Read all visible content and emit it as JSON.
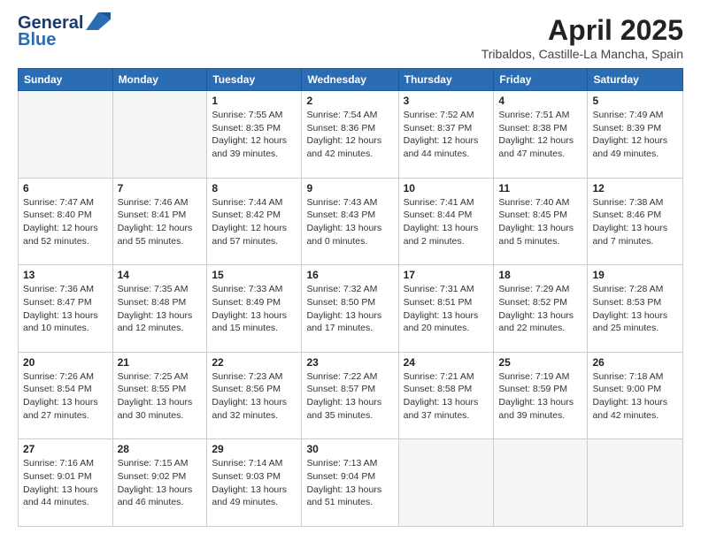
{
  "logo": {
    "line1": "General",
    "line2": "Blue"
  },
  "header": {
    "month_year": "April 2025",
    "location": "Tribaldos, Castille-La Mancha, Spain"
  },
  "days_of_week": [
    "Sunday",
    "Monday",
    "Tuesday",
    "Wednesday",
    "Thursday",
    "Friday",
    "Saturday"
  ],
  "weeks": [
    [
      {
        "day": "",
        "info": ""
      },
      {
        "day": "",
        "info": ""
      },
      {
        "day": "1",
        "info": "Sunrise: 7:55 AM\nSunset: 8:35 PM\nDaylight: 12 hours and 39 minutes."
      },
      {
        "day": "2",
        "info": "Sunrise: 7:54 AM\nSunset: 8:36 PM\nDaylight: 12 hours and 42 minutes."
      },
      {
        "day": "3",
        "info": "Sunrise: 7:52 AM\nSunset: 8:37 PM\nDaylight: 12 hours and 44 minutes."
      },
      {
        "day": "4",
        "info": "Sunrise: 7:51 AM\nSunset: 8:38 PM\nDaylight: 12 hours and 47 minutes."
      },
      {
        "day": "5",
        "info": "Sunrise: 7:49 AM\nSunset: 8:39 PM\nDaylight: 12 hours and 49 minutes."
      }
    ],
    [
      {
        "day": "6",
        "info": "Sunrise: 7:47 AM\nSunset: 8:40 PM\nDaylight: 12 hours and 52 minutes."
      },
      {
        "day": "7",
        "info": "Sunrise: 7:46 AM\nSunset: 8:41 PM\nDaylight: 12 hours and 55 minutes."
      },
      {
        "day": "8",
        "info": "Sunrise: 7:44 AM\nSunset: 8:42 PM\nDaylight: 12 hours and 57 minutes."
      },
      {
        "day": "9",
        "info": "Sunrise: 7:43 AM\nSunset: 8:43 PM\nDaylight: 13 hours and 0 minutes."
      },
      {
        "day": "10",
        "info": "Sunrise: 7:41 AM\nSunset: 8:44 PM\nDaylight: 13 hours and 2 minutes."
      },
      {
        "day": "11",
        "info": "Sunrise: 7:40 AM\nSunset: 8:45 PM\nDaylight: 13 hours and 5 minutes."
      },
      {
        "day": "12",
        "info": "Sunrise: 7:38 AM\nSunset: 8:46 PM\nDaylight: 13 hours and 7 minutes."
      }
    ],
    [
      {
        "day": "13",
        "info": "Sunrise: 7:36 AM\nSunset: 8:47 PM\nDaylight: 13 hours and 10 minutes."
      },
      {
        "day": "14",
        "info": "Sunrise: 7:35 AM\nSunset: 8:48 PM\nDaylight: 13 hours and 12 minutes."
      },
      {
        "day": "15",
        "info": "Sunrise: 7:33 AM\nSunset: 8:49 PM\nDaylight: 13 hours and 15 minutes."
      },
      {
        "day": "16",
        "info": "Sunrise: 7:32 AM\nSunset: 8:50 PM\nDaylight: 13 hours and 17 minutes."
      },
      {
        "day": "17",
        "info": "Sunrise: 7:31 AM\nSunset: 8:51 PM\nDaylight: 13 hours and 20 minutes."
      },
      {
        "day": "18",
        "info": "Sunrise: 7:29 AM\nSunset: 8:52 PM\nDaylight: 13 hours and 22 minutes."
      },
      {
        "day": "19",
        "info": "Sunrise: 7:28 AM\nSunset: 8:53 PM\nDaylight: 13 hours and 25 minutes."
      }
    ],
    [
      {
        "day": "20",
        "info": "Sunrise: 7:26 AM\nSunset: 8:54 PM\nDaylight: 13 hours and 27 minutes."
      },
      {
        "day": "21",
        "info": "Sunrise: 7:25 AM\nSunset: 8:55 PM\nDaylight: 13 hours and 30 minutes."
      },
      {
        "day": "22",
        "info": "Sunrise: 7:23 AM\nSunset: 8:56 PM\nDaylight: 13 hours and 32 minutes."
      },
      {
        "day": "23",
        "info": "Sunrise: 7:22 AM\nSunset: 8:57 PM\nDaylight: 13 hours and 35 minutes."
      },
      {
        "day": "24",
        "info": "Sunrise: 7:21 AM\nSunset: 8:58 PM\nDaylight: 13 hours and 37 minutes."
      },
      {
        "day": "25",
        "info": "Sunrise: 7:19 AM\nSunset: 8:59 PM\nDaylight: 13 hours and 39 minutes."
      },
      {
        "day": "26",
        "info": "Sunrise: 7:18 AM\nSunset: 9:00 PM\nDaylight: 13 hours and 42 minutes."
      }
    ],
    [
      {
        "day": "27",
        "info": "Sunrise: 7:16 AM\nSunset: 9:01 PM\nDaylight: 13 hours and 44 minutes."
      },
      {
        "day": "28",
        "info": "Sunrise: 7:15 AM\nSunset: 9:02 PM\nDaylight: 13 hours and 46 minutes."
      },
      {
        "day": "29",
        "info": "Sunrise: 7:14 AM\nSunset: 9:03 PM\nDaylight: 13 hours and 49 minutes."
      },
      {
        "day": "30",
        "info": "Sunrise: 7:13 AM\nSunset: 9:04 PM\nDaylight: 13 hours and 51 minutes."
      },
      {
        "day": "",
        "info": ""
      },
      {
        "day": "",
        "info": ""
      },
      {
        "day": "",
        "info": ""
      }
    ]
  ]
}
